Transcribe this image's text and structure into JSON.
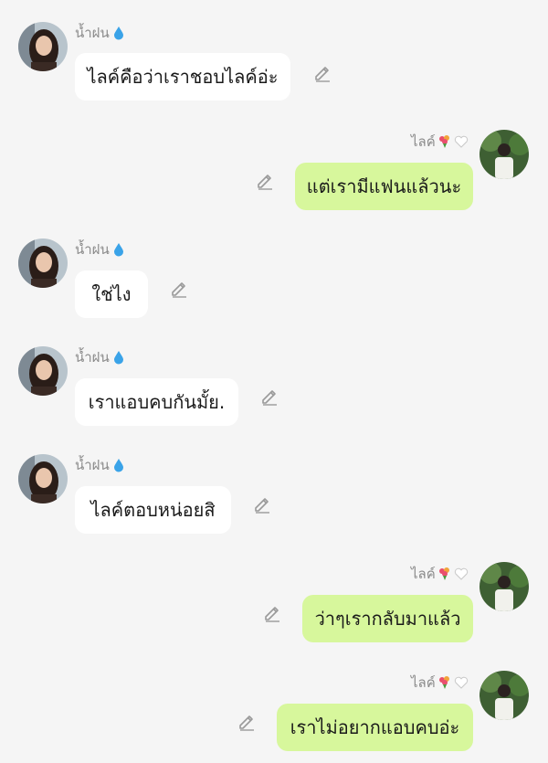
{
  "contacts": {
    "incoming_name": "น้ำฝน",
    "outgoing_name": "ไลค์"
  },
  "icons": {
    "name_suffix_incoming": "water-drop-icon",
    "name_suffix_outgoing": [
      "flower-bouquet-icon",
      "white-heart-icon"
    ],
    "edit": "pencil-icon"
  },
  "colors": {
    "background": "#f5f5f5",
    "incoming_bubble": "#ffffff",
    "outgoing_bubble": "#d7f79c",
    "name_text": "#8a8a8a",
    "icon_gray": "#9a9a9a"
  },
  "messages": [
    {
      "side": "in",
      "text": "ไลค์คือว่าเราชอบไลค์อ่ะ"
    },
    {
      "side": "out",
      "text": "แต่เรามีแฟนแล้วนะ"
    },
    {
      "side": "in",
      "text": "ใช่ไง"
    },
    {
      "side": "in",
      "text": "เราแอบคบกันมั้ย."
    },
    {
      "side": "in",
      "text": "ไลค์ตอบหน่อยสิ"
    },
    {
      "side": "out",
      "text": "ว่าๆเรากลับมาแล้ว"
    },
    {
      "side": "out",
      "text": "เราไม่อยากแอบคบอ่ะ"
    }
  ]
}
